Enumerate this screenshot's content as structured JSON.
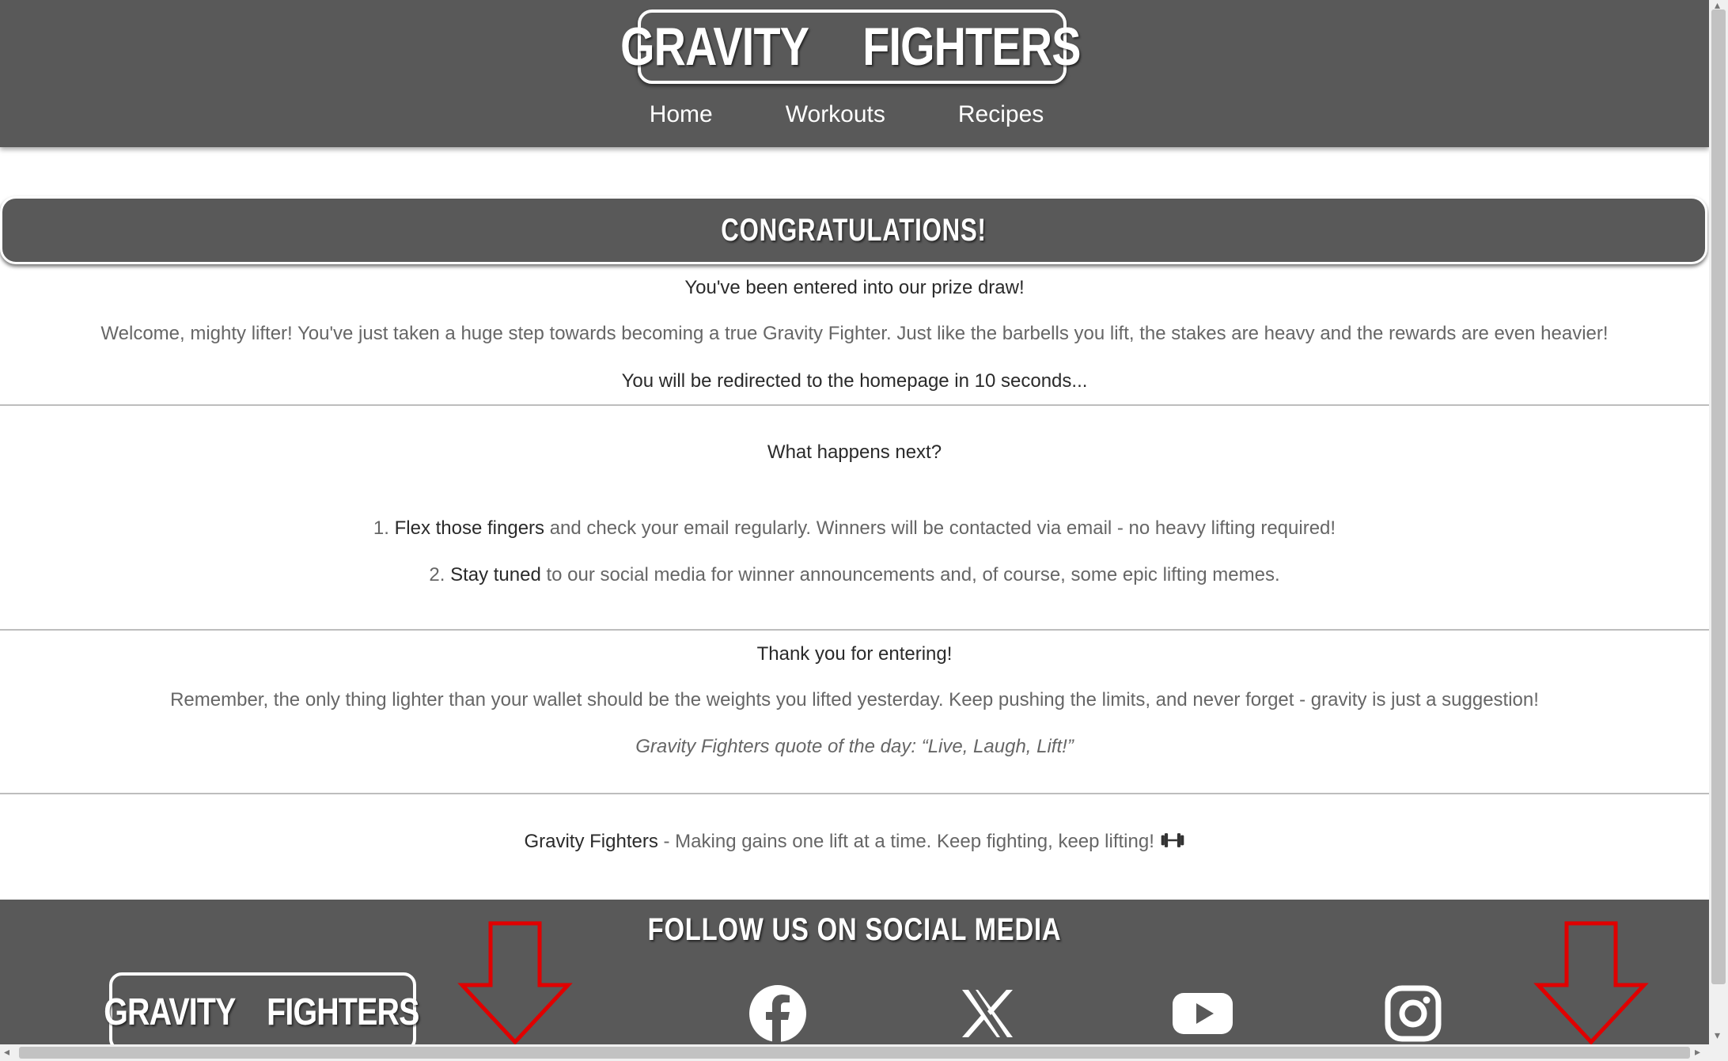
{
  "header": {
    "logo_left": "GRAVITY",
    "logo_right": "FIGHTERS",
    "logo_icon": "dumbbell-icon",
    "nav": [
      "Home",
      "Workouts",
      "Recipes"
    ]
  },
  "banner": {
    "title": "CONGRATULATIONS!"
  },
  "entry": {
    "subtitle": "You've been entered into our prize draw!",
    "welcome": "Welcome, mighty lifter! You've just taken a huge step towards becoming a true Gravity Fighter. Just like the barbells you lift, the stakes are heavy and the rewards are even heavier!",
    "redirect": "You will be redirected to the homepage in 10 seconds..."
  },
  "next": {
    "heading": "What happens next?",
    "steps": [
      {
        "number": "1.",
        "bold": "Flex those fingers",
        "text": " and check your email regularly. Winners will be contacted via email - no heavy lifting required!"
      },
      {
        "number": "2.",
        "bold": "Stay tuned",
        "text": " to our social media for winner announcements and, of course, some epic lifting memes."
      }
    ]
  },
  "thanks": {
    "heading": "Thank you for entering!",
    "text": "Remember, the only thing lighter than your wallet should be the weights you lifted yesterday. Keep pushing the limits, and never forget - gravity is just a suggestion!",
    "quote": "Gravity Fighters quote of the day: “Live, Laugh, Lift!”"
  },
  "tagline": {
    "brand": "Gravity Fighters",
    "text": " - Making gains one lift at a time. Keep fighting, keep lifting! "
  },
  "footer": {
    "title": "FOLLOW US ON SOCIAL MEDIA",
    "logo_left": "GRAVITY",
    "logo_right": "FIGHTERS",
    "social": [
      "facebook-icon",
      "x-icon",
      "youtube-icon",
      "instagram-icon"
    ]
  },
  "colors": {
    "header_bg": "#595959",
    "text": "#666666",
    "arrow": "#e00000"
  }
}
